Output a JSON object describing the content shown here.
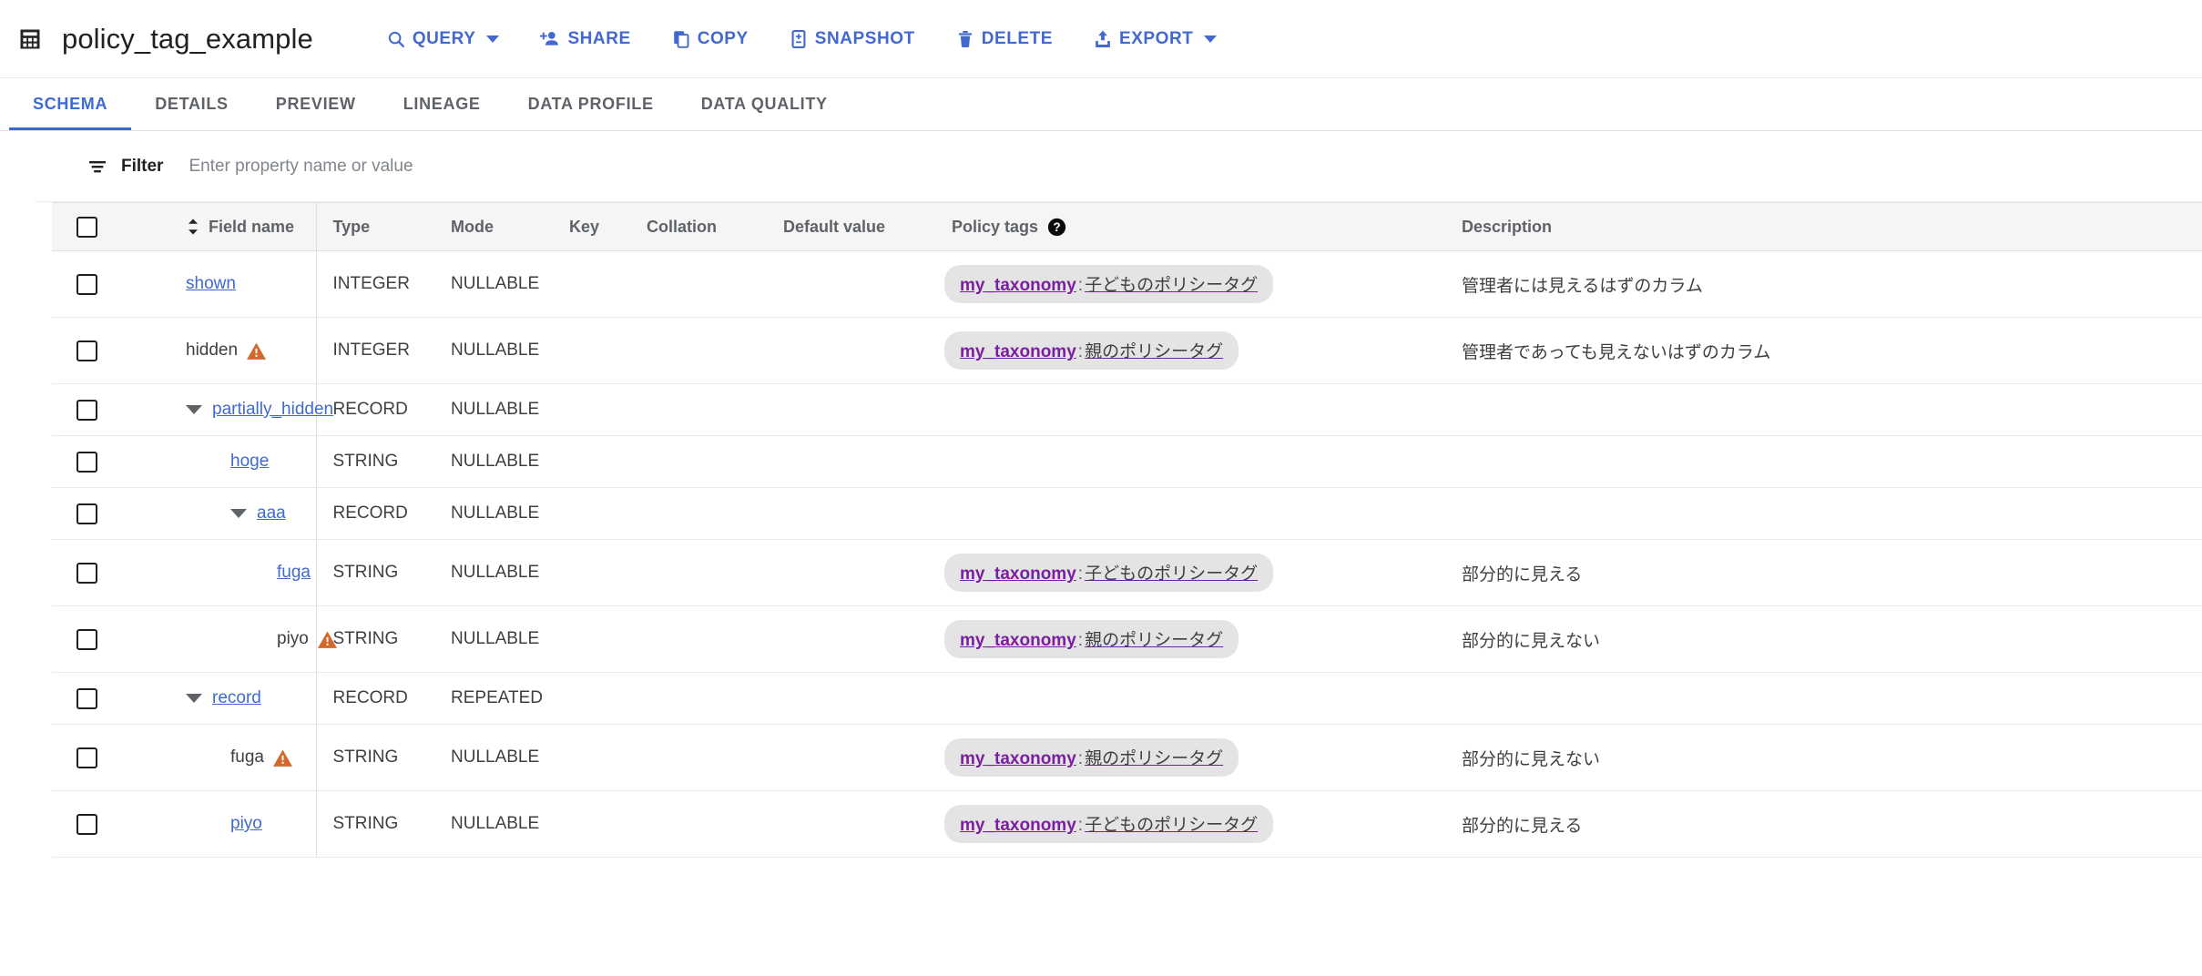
{
  "header": {
    "icon": "table-grid-icon",
    "title": "policy_tag_example",
    "toolbar": [
      {
        "id": "query",
        "label": "QUERY",
        "icon": "search-icon",
        "has_caret": true
      },
      {
        "id": "share",
        "label": "SHARE",
        "icon": "person-add-icon",
        "has_caret": false
      },
      {
        "id": "copy",
        "label": "COPY",
        "icon": "copy-icon",
        "has_caret": false
      },
      {
        "id": "snapshot",
        "label": "SNAPSHOT",
        "icon": "snapshot-icon",
        "has_caret": false
      },
      {
        "id": "delete",
        "label": "DELETE",
        "icon": "trash-icon",
        "has_caret": false
      },
      {
        "id": "export",
        "label": "EXPORT",
        "icon": "upload-icon",
        "has_caret": true
      }
    ]
  },
  "tabs": [
    {
      "id": "schema",
      "label": "SCHEMA",
      "active": true
    },
    {
      "id": "details",
      "label": "DETAILS",
      "active": false
    },
    {
      "id": "preview",
      "label": "PREVIEW",
      "active": false
    },
    {
      "id": "lineage",
      "label": "LINEAGE",
      "active": false
    },
    {
      "id": "data-profile",
      "label": "DATA PROFILE",
      "active": false
    },
    {
      "id": "data-quality",
      "label": "DATA QUALITY",
      "active": false
    }
  ],
  "filter": {
    "icon": "filter-list-icon",
    "label": "Filter",
    "placeholder": "Enter property name or value",
    "value": ""
  },
  "table": {
    "columns": {
      "field_name": "Field name",
      "type": "Type",
      "mode": "Mode",
      "key": "Key",
      "collation": "Collation",
      "default_value": "Default value",
      "policy_tags": "Policy tags",
      "description": "Description"
    },
    "policy_tags_help_icon": "help-icon",
    "sort_icon": "sort-updown-icon",
    "rows": [
      {
        "name": "shown",
        "indent": 0,
        "link": true,
        "expandable": false,
        "warning": false,
        "type": "INTEGER",
        "mode": "NULLABLE",
        "key": "",
        "collation": "",
        "default_value": "",
        "policy_taxonomy": "my_taxonomy",
        "policy_separator": ":",
        "policy_tag": "子どものポリシータグ",
        "description": "管理者には見えるはずのカラム"
      },
      {
        "name": "hidden",
        "indent": 0,
        "link": false,
        "expandable": false,
        "warning": true,
        "type": "INTEGER",
        "mode": "NULLABLE",
        "key": "",
        "collation": "",
        "default_value": "",
        "policy_taxonomy": "my_taxonomy",
        "policy_separator": ":",
        "policy_tag": "親のポリシータグ",
        "description": "管理者であっても見えないはずのカラム"
      },
      {
        "name": "partially_hidden",
        "indent": 0,
        "link": true,
        "expandable": true,
        "warning": false,
        "type": "RECORD",
        "mode": "NULLABLE",
        "key": "",
        "collation": "",
        "default_value": "",
        "policy_taxonomy": "",
        "policy_separator": "",
        "policy_tag": "",
        "description": ""
      },
      {
        "name": "hoge",
        "indent": 1,
        "link": true,
        "expandable": false,
        "warning": false,
        "type": "STRING",
        "mode": "NULLABLE",
        "key": "",
        "collation": "",
        "default_value": "",
        "policy_taxonomy": "",
        "policy_separator": "",
        "policy_tag": "",
        "description": ""
      },
      {
        "name": "aaa",
        "indent": 1,
        "link": true,
        "expandable": true,
        "warning": false,
        "type": "RECORD",
        "mode": "NULLABLE",
        "key": "",
        "collation": "",
        "default_value": "",
        "policy_taxonomy": "",
        "policy_separator": "",
        "policy_tag": "",
        "description": ""
      },
      {
        "name": "fuga",
        "indent": 2,
        "link": true,
        "expandable": false,
        "warning": false,
        "type": "STRING",
        "mode": "NULLABLE",
        "key": "",
        "collation": "",
        "default_value": "",
        "policy_taxonomy": "my_taxonomy",
        "policy_separator": ":",
        "policy_tag": "子どものポリシータグ",
        "description": "部分的に見える"
      },
      {
        "name": "piyo",
        "indent": 2,
        "link": false,
        "expandable": false,
        "warning": true,
        "type": "STRING",
        "mode": "NULLABLE",
        "key": "",
        "collation": "",
        "default_value": "",
        "policy_taxonomy": "my_taxonomy",
        "policy_separator": ":",
        "policy_tag": "親のポリシータグ",
        "description": "部分的に見えない"
      },
      {
        "name": "record",
        "indent": 0,
        "link": true,
        "expandable": true,
        "warning": false,
        "type": "RECORD",
        "mode": "REPEATED",
        "key": "",
        "collation": "",
        "default_value": "",
        "policy_taxonomy": "",
        "policy_separator": "",
        "policy_tag": "",
        "description": ""
      },
      {
        "name": "fuga",
        "indent": 1,
        "link": false,
        "expandable": false,
        "warning": true,
        "type": "STRING",
        "mode": "NULLABLE",
        "key": "",
        "collation": "",
        "default_value": "",
        "policy_taxonomy": "my_taxonomy",
        "policy_separator": ":",
        "policy_tag": "親のポリシータグ",
        "description": "部分的に見えない"
      },
      {
        "name": "piyo",
        "indent": 1,
        "link": true,
        "expandable": false,
        "warning": false,
        "type": "STRING",
        "mode": "NULLABLE",
        "key": "",
        "collation": "",
        "default_value": "",
        "policy_taxonomy": "my_taxonomy",
        "policy_separator": ":",
        "policy_tag": "子どものポリシータグ",
        "description": "部分的に見える"
      }
    ]
  },
  "colors": {
    "accent": "#3f6ad0",
    "toolbar_blue": "#4368d0",
    "taxonomy_purple": "#7b1fa2",
    "warning_orange": "#d2692a",
    "chip_bg": "#e4e4e4",
    "header_bg": "#f5f5f5"
  }
}
